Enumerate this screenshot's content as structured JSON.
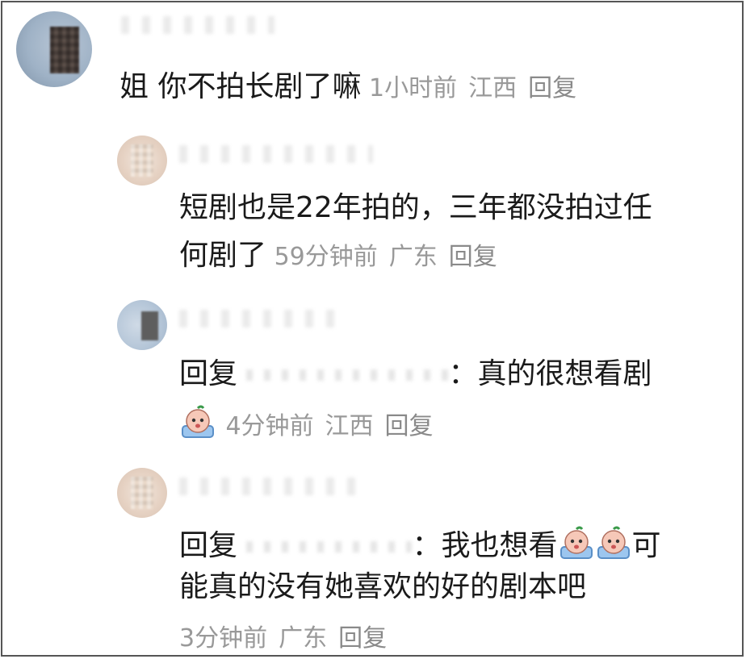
{
  "comments": [
    {
      "text": "姐 你不拍长剧了嘛",
      "time": "1小时前",
      "location": "江西",
      "reply_label": "回复"
    },
    {
      "text_line1": "短剧也是22年拍的，三年都没拍过任",
      "text_line2": "何剧了",
      "time": "59分钟前",
      "location": "广东",
      "reply_label": "回复"
    },
    {
      "reply_prefix": "回复",
      "colon": "：",
      "text": "真的很想看剧",
      "emoji": "crying-face-emoji",
      "time": "4分钟前",
      "location": "江西",
      "reply_label": "回复"
    },
    {
      "reply_prefix": "回复",
      "colon": "：",
      "text_part1": "我也想看",
      "emojis": [
        "crying-face-emoji",
        "crying-face-emoji"
      ],
      "text_part2": "可",
      "text_line2": "能真的没有她喜欢的好的剧本吧",
      "time": "3分钟前",
      "location": "广东",
      "reply_label": "回复"
    }
  ],
  "colors": {
    "text": "#1a1a1a",
    "meta": "#999999",
    "border": "#555555"
  }
}
